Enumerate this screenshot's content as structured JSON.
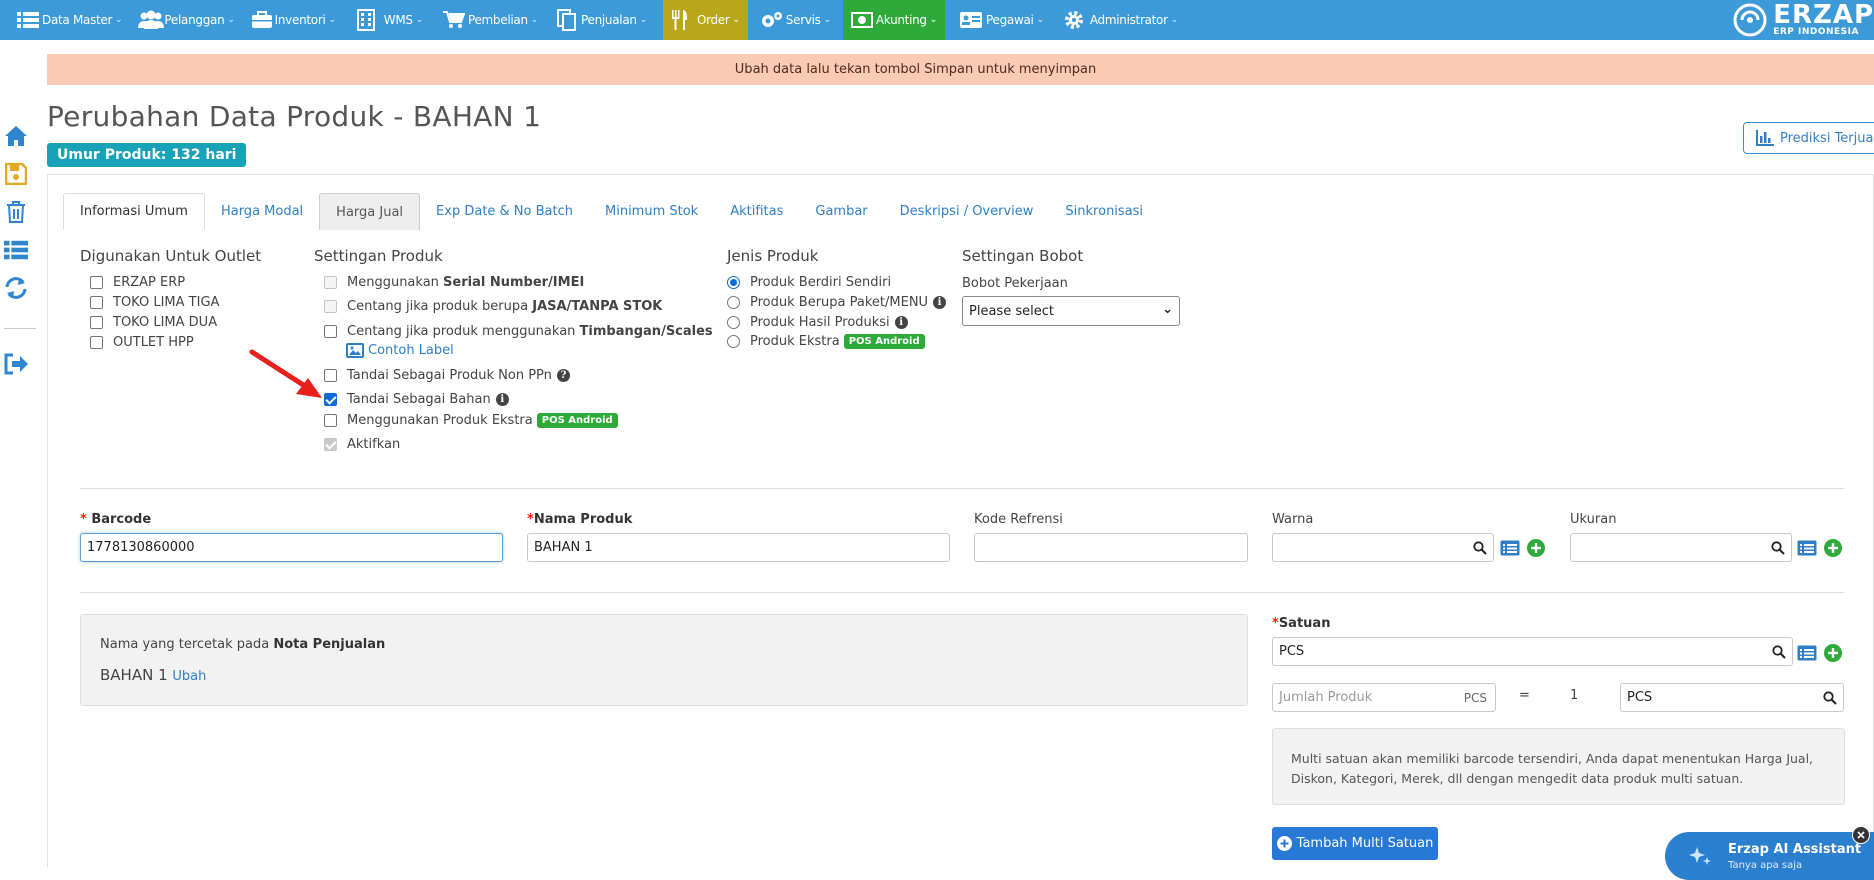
{
  "nav": {
    "items": [
      {
        "label": "Data Master",
        "icon": "list-icon"
      },
      {
        "label": "Pelanggan",
        "icon": "users-icon"
      },
      {
        "label": "Inventori",
        "icon": "briefcase-icon"
      },
      {
        "label": "WMS",
        "icon": "building-icon"
      },
      {
        "label": "Pembelian",
        "icon": "cart-icon"
      },
      {
        "label": "Penjualan",
        "icon": "document-icon"
      },
      {
        "label": "Order",
        "icon": "utensils-icon"
      },
      {
        "label": "Servis",
        "icon": "gears-icon"
      },
      {
        "label": "Akunting",
        "icon": "money-icon"
      },
      {
        "label": "Pegawai",
        "icon": "id-card-icon"
      },
      {
        "label": "Administrator",
        "icon": "gear-icon"
      }
    ],
    "logo_big": "ERZAP",
    "logo_small": "ERP INDONESIA",
    "order_color": "#b8a71b",
    "akunting_color": "#2eaa3a"
  },
  "alert": "Ubah data lalu tekan tombol Simpan untuk menyimpan",
  "page": {
    "title": "Perubahan Data Produk - BAHAN 1",
    "age_badge": "Umur Produk: 132 hari",
    "predict_button": "Prediksi Terjual"
  },
  "tabs": [
    "Informasi Umum",
    "Harga Modal",
    "Harga Jual",
    "Exp Date & No Batch",
    "Minimum Stok",
    "Aktifitas",
    "Gambar",
    "Deskripsi / Overview",
    "Sinkronisasi"
  ],
  "outlet": {
    "title": "Digunakan Untuk Outlet",
    "items": [
      "ERZAP ERP",
      "TOKO LIMA TIGA",
      "TOKO LIMA DUA",
      "OUTLET HPP"
    ]
  },
  "settings": {
    "title": "Settingan Produk",
    "serial_pre": "Menggunakan ",
    "serial_bold": "Serial Number/IMEI",
    "jasa_pre": "Centang jika produk berupa ",
    "jasa_bold": "JASA/TANPA STOK",
    "scale_pre": "Centang jika produk menggunakan ",
    "scale_bold": "Timbangan/Scales",
    "scale_link": "Contoh Label",
    "non_ppn": "Tandai Sebagai Produk Non PPn",
    "bahan": "Tandai Sebagai Bahan",
    "ekstra": "Menggunakan Produk Ekstra",
    "ekstra_badge": "POS Android",
    "aktifkan": "Aktifkan"
  },
  "jenis": {
    "title": "Jenis Produk",
    "items": [
      "Produk Berdiri Sendiri",
      "Produk Berupa Paket/MENU",
      "Produk Hasil Produksi",
      "Produk Ekstra"
    ],
    "badge": "POS Android"
  },
  "bobot": {
    "title": "Settingan Bobot",
    "label": "Bobot Pekerjaan",
    "select": "Please select"
  },
  "fields": {
    "barcode_label": "Barcode",
    "barcode_value": "1778130860000",
    "nama_label": "Nama Produk",
    "nama_value": "BAHAN 1",
    "kode_label": "Kode Refrensi",
    "warna_label": "Warna",
    "ukuran_label": "Ukuran"
  },
  "nota": {
    "label_pre": "Nama yang tercetak pada ",
    "label_bold": "Nota Penjualan",
    "name": "BAHAN 1",
    "link": "Ubah"
  },
  "satuan": {
    "label": "Satuan",
    "value": "PCS",
    "jumlah_placeholder": "Jumlah Produk",
    "jumlah_suffix": "PCS",
    "equals": "=",
    "qty": "1",
    "unit": "PCS",
    "info": "Multi satuan akan memiliki barcode tersendiri, Anda dapat menentukan Harga Jual, Diskon, Kategori, Merek, dll dengan mengedit data produk multi satuan.",
    "add_button": "Tambah Multi Satuan"
  },
  "ai": {
    "title": "Erzap AI Assistant",
    "subtitle": "Tanya apa saja"
  }
}
